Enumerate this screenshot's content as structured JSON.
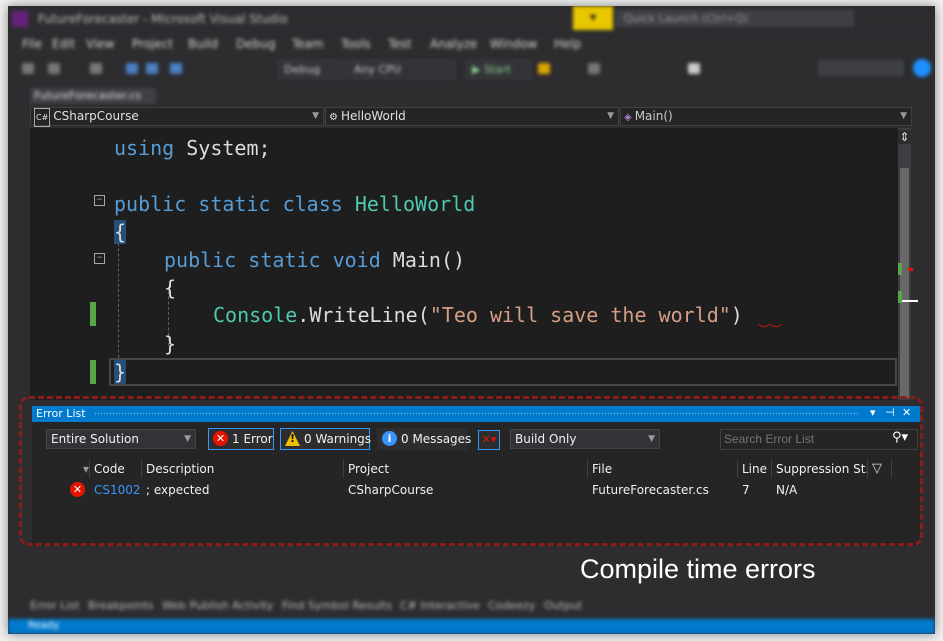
{
  "window": {
    "title": "FutureForecaster - Microsoft Visual Studio",
    "live_share": "▾",
    "quick_launch": "Quick Launch (Ctrl+Q)"
  },
  "menu": [
    "File",
    "Edit",
    "View",
    "Project",
    "Build",
    "Debug",
    "Team",
    "Tools",
    "Test",
    "Analyze",
    "Window",
    "Help"
  ],
  "toolbar": {
    "config": "Debug",
    "platform": "Any CPU",
    "start": "▶ Start"
  },
  "doc_tab": "FutureForecaster.cs",
  "navbar": {
    "project": {
      "icon": "C#",
      "label": "CSharpCourse"
    },
    "class": {
      "icon": "⚙",
      "label": "HelloWorld"
    },
    "member": {
      "icon": "◈",
      "label": "Main()"
    }
  },
  "code": {
    "line1_kw": "using",
    "line1_rest": " System;",
    "line2_kw": "public static class ",
    "line2_type": "HelloWorld",
    "line3": "{",
    "line4_kw": "public static void ",
    "line4_rest": "Main()",
    "line5": "{",
    "line6_type": "Console",
    "line6_method": ".WriteLine(",
    "line6_str": "\"Teo will save the world\"",
    "line6_close": ")",
    "line7": "}",
    "line8": "}"
  },
  "error_list": {
    "title": "Error List",
    "scope": "Entire Solution",
    "errors_toggle": "1 Error",
    "warnings_toggle": "0 Warnings",
    "messages_toggle": "0 Messages",
    "build_filter": "Build Only",
    "search_placeholder": "Search Error List",
    "columns": [
      "Code",
      "Description",
      "Project",
      "File",
      "Line",
      "Suppression St..."
    ],
    "rows": [
      {
        "code": "CS1002",
        "description": "; expected",
        "project": "CSharpCourse",
        "file": "FutureForecaster.cs",
        "line": "7",
        "suppression": "N/A"
      }
    ]
  },
  "caption": "Compile time errors",
  "bottom_tabs": [
    "Error List",
    "Breakpoints",
    "Web Publish Activity",
    "Find Symbol Results",
    "C# Interactive",
    "Codeezy",
    "Output"
  ],
  "status": "Ready",
  "colors": {
    "keyword": "#569cd6",
    "type": "#4ec9b0",
    "string": "#d69d85",
    "error": "#e51400",
    "accent": "#007acc"
  }
}
